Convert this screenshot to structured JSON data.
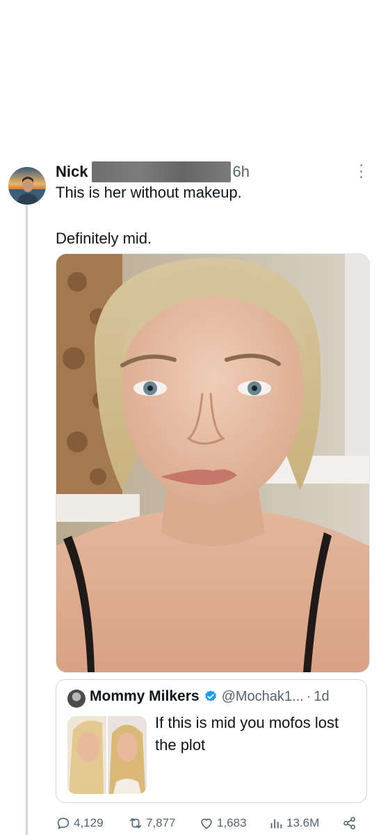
{
  "tweet": {
    "author_name": "Nick",
    "time": "6h",
    "text_line1": "This is her without makeup.",
    "text_line2": "Definitely mid."
  },
  "quote": {
    "name": "Mommy Milkers",
    "handle": "@Mochak1...",
    "separator": "·",
    "time": "1d",
    "text": "If this is mid you mofos lost the plot"
  },
  "actions": {
    "replies": "4,129",
    "reposts": "7,877",
    "likes": "1,683",
    "views": "13.6M"
  },
  "colors": {
    "text": "#0f1419",
    "secondary": "#536471",
    "border": "#cfd9de",
    "verified": "#1d9bf0"
  },
  "icons": [
    "more-icon",
    "verified-icon",
    "reply-icon",
    "repost-icon",
    "like-icon",
    "views-icon",
    "share-icon"
  ]
}
